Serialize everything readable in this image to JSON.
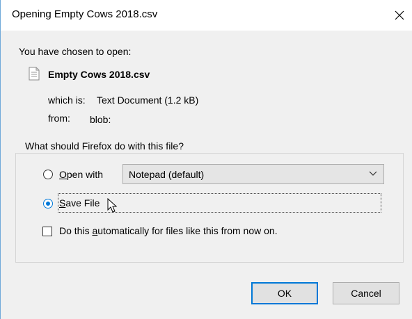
{
  "window": {
    "title": "Opening Empty Cows 2018.csv",
    "close_icon": "close-icon"
  },
  "dialog": {
    "chosen_text": "You have chosen to open:",
    "file_icon": "text-document-icon",
    "filename": "Empty Cows 2018.csv",
    "which_is_label": "which is:",
    "which_is_value": "Text Document (1.2 kB)",
    "from_label": "from:",
    "from_value": "blob:"
  },
  "action_group": {
    "legend": "What should Firefox do with this file?",
    "open_with": {
      "mnemonic": "O",
      "rest": "pen with",
      "selected": false,
      "app_value": "Notepad (default)"
    },
    "save_file": {
      "mnemonic": "S",
      "rest": "ave File",
      "selected": true
    },
    "auto": {
      "prefix": "Do this ",
      "mnemonic": "a",
      "rest": "utomatically for files like this from now on.",
      "checked": false
    }
  },
  "buttons": {
    "ok": "OK",
    "cancel": "Cancel"
  },
  "colors": {
    "accent": "#0078d7",
    "content_bg": "#f0f0f0"
  }
}
